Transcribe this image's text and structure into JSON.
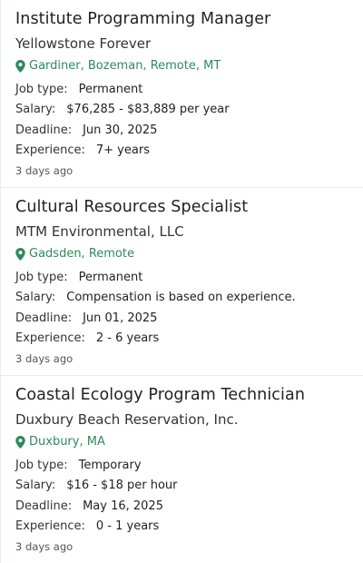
{
  "jobs": [
    {
      "title": "Institute Programming Manager",
      "company": "Yellowstone Forever",
      "location": "Gardiner, Bozeman, Remote, MT",
      "job_type_label": "Job type:",
      "job_type": "Permanent",
      "salary_label": "Salary:",
      "salary": "$76,285 - $83,889 per year",
      "deadline_label": "Deadline:",
      "deadline": "Jun 30, 2025",
      "experience_label": "Experience:",
      "experience": "7+ years",
      "posted": "3 days ago"
    },
    {
      "title": "Cultural Resources Specialist",
      "company": "MTM Environmental, LLC",
      "location": "Gadsden, Remote",
      "job_type_label": "Job type:",
      "job_type": "Permanent",
      "salary_label": "Salary:",
      "salary": "Compensation is based on experience.",
      "deadline_label": "Deadline:",
      "deadline": "Jun 01, 2025",
      "experience_label": "Experience:",
      "experience": "2 - 6 years",
      "posted": "3 days ago"
    },
    {
      "title": "Coastal Ecology Program Technician",
      "company": "Duxbury Beach Reservation, Inc.",
      "location": "Duxbury, MA",
      "job_type_label": "Job type:",
      "job_type": "Temporary",
      "salary_label": "Salary:",
      "salary": "$16 - $18 per hour",
      "deadline_label": "Deadline:",
      "deadline": "May 16, 2025",
      "experience_label": "Experience:",
      "experience": "0 - 1 years",
      "posted": "3 days ago"
    }
  ],
  "colors": {
    "location": "#2e8a5e",
    "divider": "#e6eceb"
  },
  "icons": {
    "location": "map-pin-icon"
  }
}
